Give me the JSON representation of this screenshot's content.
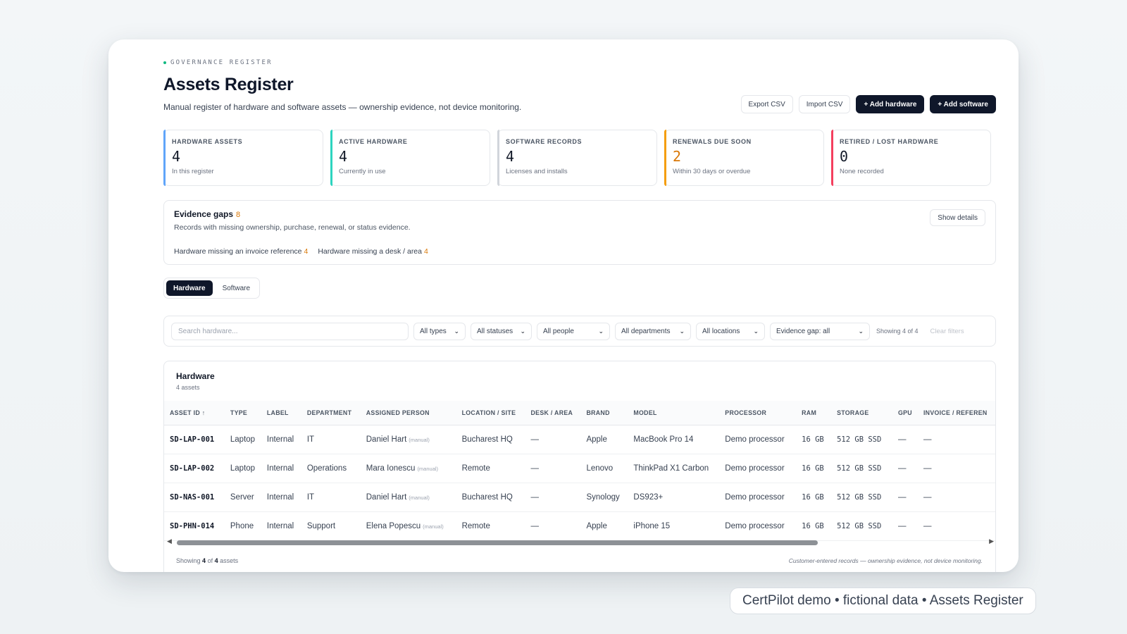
{
  "header": {
    "eyebrow": "GOVERNANCE REGISTER",
    "title": "Assets Register",
    "subtitle": "Manual register of hardware and software assets — ownership evidence, not device monitoring.",
    "actions": {
      "export": "Export CSV",
      "import": "Import CSV",
      "add_hardware": "+ Add hardware",
      "add_software": "+ Add software"
    }
  },
  "stats": [
    {
      "label": "HARDWARE ASSETS",
      "value": "4",
      "note": "In this register",
      "accent": "#60a5fa",
      "value_color": "#111827"
    },
    {
      "label": "ACTIVE HARDWARE",
      "value": "4",
      "note": "Currently in use",
      "accent": "#2dd4bf",
      "value_color": "#111827"
    },
    {
      "label": "SOFTWARE RECORDS",
      "value": "4",
      "note": "Licenses and installs",
      "accent": "#d1d5db",
      "value_color": "#111827"
    },
    {
      "label": "RENEWALS DUE SOON",
      "value": "2",
      "note": "Within 30 days or overdue",
      "accent": "#f59e0b",
      "value_color": "#d97706"
    },
    {
      "label": "RETIRED / LOST HARDWARE",
      "value": "0",
      "note": "None recorded",
      "accent": "#f43f5e",
      "value_color": "#111827"
    }
  ],
  "evidence_gaps": {
    "title": "Evidence gaps",
    "count": "8",
    "description": "Records with missing ownership, purchase, renewal, or status evidence.",
    "show_details": "Show details",
    "items": [
      {
        "label": "Hardware missing an invoice reference",
        "count": "4"
      },
      {
        "label": "Hardware missing a desk / area",
        "count": "4"
      }
    ]
  },
  "tabs": [
    {
      "label": "Hardware",
      "active": true
    },
    {
      "label": "Software",
      "active": false
    }
  ],
  "filters": {
    "search_placeholder": "Search hardware...",
    "types": "All types",
    "statuses": "All statuses",
    "people": "All people",
    "departments": "All departments",
    "locations": "All locations",
    "evidence": "Evidence gap: all",
    "showing": "Showing 4 of 4",
    "clear": "Clear filters"
  },
  "table": {
    "title": "Hardware",
    "subtitle": "4 assets",
    "columns": [
      "ASSET ID ↑",
      "TYPE",
      "LABEL",
      "DEPARTMENT",
      "ASSIGNED PERSON",
      "LOCATION / SITE",
      "DESK / AREA",
      "BRAND",
      "MODEL",
      "PROCESSOR",
      "RAM",
      "STORAGE",
      "GPU",
      "INVOICE / REFEREN"
    ],
    "manual_tag": "(manual)",
    "rows": [
      {
        "id": "SD-LAP-001",
        "type": "Laptop",
        "label": "Internal",
        "department": "IT",
        "person": "Daniel Hart",
        "location": "Bucharest HQ",
        "desk": "—",
        "brand": "Apple",
        "model": "MacBook Pro 14",
        "processor": "Demo processor",
        "ram": "16 GB",
        "storage": "512 GB SSD",
        "gpu": "—",
        "invoice": "—"
      },
      {
        "id": "SD-LAP-002",
        "type": "Laptop",
        "label": "Internal",
        "department": "Operations",
        "person": "Mara Ionescu",
        "location": "Remote",
        "desk": "—",
        "brand": "Lenovo",
        "model": "ThinkPad X1 Carbon",
        "processor": "Demo processor",
        "ram": "16 GB",
        "storage": "512 GB SSD",
        "gpu": "—",
        "invoice": "—"
      },
      {
        "id": "SD-NAS-001",
        "type": "Server",
        "label": "Internal",
        "department": "IT",
        "person": "Daniel Hart",
        "location": "Bucharest HQ",
        "desk": "—",
        "brand": "Synology",
        "model": "DS923+",
        "processor": "Demo processor",
        "ram": "16 GB",
        "storage": "512 GB SSD",
        "gpu": "—",
        "invoice": "—"
      },
      {
        "id": "SD-PHN-014",
        "type": "Phone",
        "label": "Internal",
        "department": "Support",
        "person": "Elena Popescu",
        "location": "Remote",
        "desk": "—",
        "brand": "Apple",
        "model": "iPhone 15",
        "processor": "Demo processor",
        "ram": "16 GB",
        "storage": "512 GB SSD",
        "gpu": "—",
        "invoice": "—"
      }
    ],
    "footer_prefix": "Showing",
    "footer_shown": "4",
    "footer_of": "of",
    "footer_total": "4",
    "footer_suffix": "assets",
    "footer_note": "Customer-entered records — ownership evidence, not device monitoring."
  },
  "caption": "CertPilot demo • fictional data • Assets Register"
}
